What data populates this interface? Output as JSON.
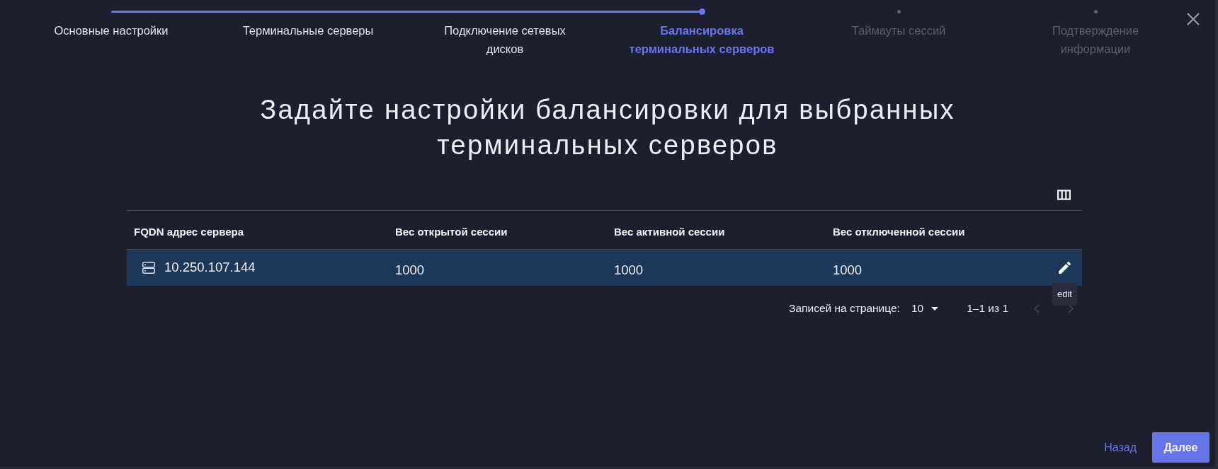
{
  "stepper": {
    "steps": [
      {
        "label": "Основные настройки",
        "completed": true,
        "selected": false
      },
      {
        "label": "Терминальные серверы",
        "completed": true,
        "selected": false
      },
      {
        "label": "Подключение сетевых дисков",
        "completed": true,
        "selected": false
      },
      {
        "label": "Балансировка терминальных серверов",
        "completed": false,
        "selected": true
      },
      {
        "label": "Таймауты сессий",
        "completed": false,
        "selected": false
      },
      {
        "label": "Подтверждение информации",
        "completed": false,
        "selected": false
      }
    ]
  },
  "title": "Задайте настройки балансировки для выбранных терминальных серверов",
  "table": {
    "columns": [
      "FQDN адрес сервера",
      "Вес открытой сессии",
      "Вес активной сессии",
      "Вес отключенной сессии"
    ],
    "rows": [
      {
        "cells": [
          "10.250.107.144",
          "1000",
          "1000",
          "1000"
        ],
        "highlighted": true
      }
    ],
    "tooltip": "edit"
  },
  "pagination": {
    "rows_per_page_label": "Записей на странице:",
    "rows_per_page": "10",
    "range": "1–1 из 1",
    "prev_disabled": true,
    "next_disabled": true
  },
  "footer": {
    "back": "Назад",
    "next": "Далее"
  }
}
